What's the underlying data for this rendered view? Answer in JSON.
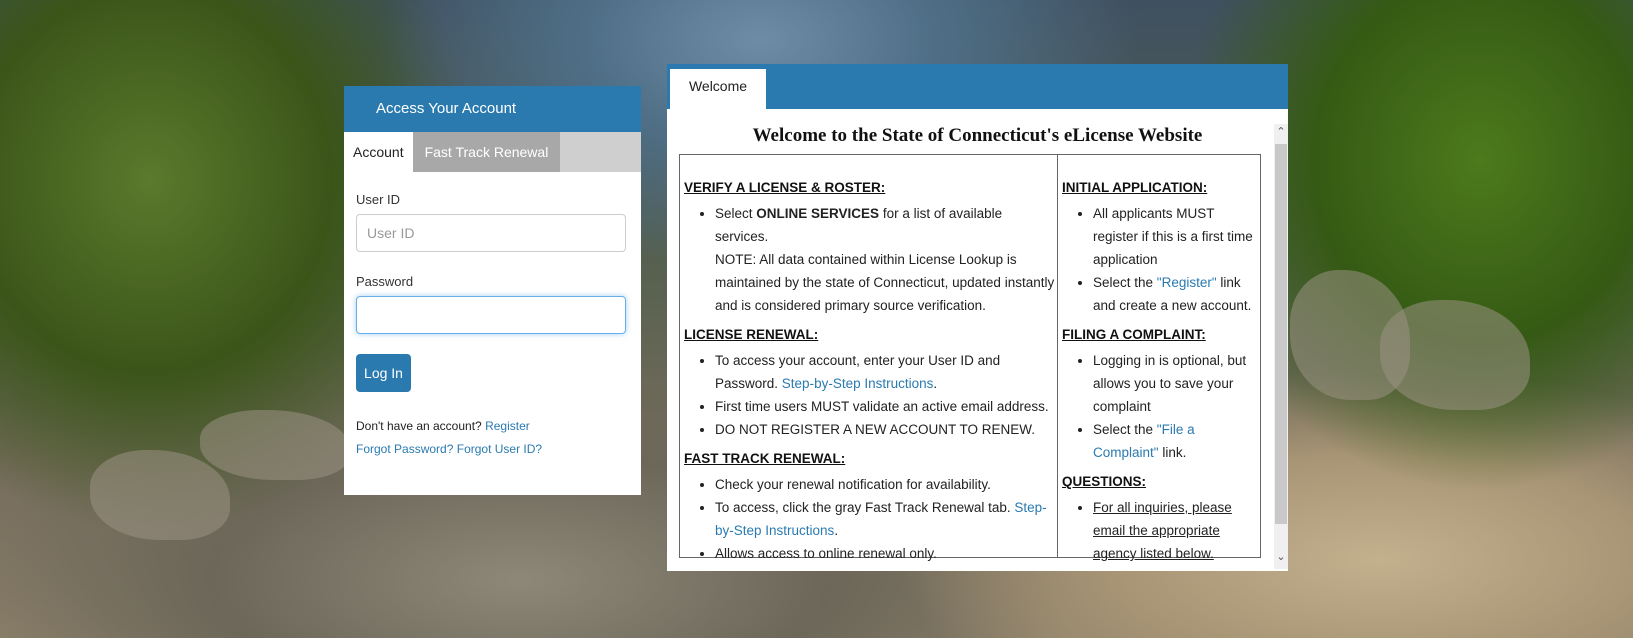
{
  "login": {
    "header": "Access Your Account",
    "tabs": {
      "account": "Account",
      "fast_track": "Fast Track Renewal"
    },
    "user_id_label": "User ID",
    "user_id_placeholder": "User ID",
    "password_label": "Password",
    "login_button": "Log In",
    "no_account_text": "Don't have an account?",
    "register_link": "Register",
    "forgot_password_link": "Forgot Password?",
    "forgot_userid_link": "Forgot User ID?"
  },
  "welcome": {
    "tab": "Welcome",
    "title": "Welcome to the State of Connecticut's eLicense Website",
    "scroll_up_icon": "chevron-up-icon",
    "scroll_down_icon": "chevron-down-icon",
    "left": {
      "verify_head": "VERIFY A LICENSE & ROSTER:",
      "verify_select_pre": "Select ",
      "verify_select_bold": "ONLINE SERVICES",
      "verify_select_post": " for a list of available services.",
      "verify_note": "NOTE: All data contained within License Lookup is maintained by the state of Connecticut, updated instantly and is considered primary source verification.",
      "renewal_head": "LICENSE RENEWAL:",
      "renewal_item1_text": "To access your account, enter your User ID and Password.",
      "renewal_item1_link": "Step-by-Step Instructions",
      "renewal_item2": "First time users MUST validate an active email address.",
      "renewal_item3": "DO NOT REGISTER A NEW ACCOUNT TO RENEW.",
      "fast_head": "FAST TRACK RENEWAL:",
      "fast_item1": "Check your renewal notification for availability.",
      "fast_item2_text": "To access, click the gray Fast Track Renewal tab.",
      "fast_item2_link": "Step-by-Step Instructions",
      "fast_item3": "Allows access to online renewal only."
    },
    "right": {
      "initial_head": "INITIAL APPLICATION:",
      "initial_item1": "All applicants MUST register if this is a first time application",
      "initial_item2_pre": "Select the ",
      "initial_item2_link": "\"Register\"",
      "initial_item2_post": " link and create a new account.",
      "complaint_head": "FILING A COMPLAINT:",
      "complaint_item1": "Logging in is optional, but allows you to save your complaint",
      "complaint_item2_pre": "Select the ",
      "complaint_item2_link": "\"File a Complaint\"",
      "complaint_item2_post": " link.",
      "questions_head": "QUESTIONS:",
      "questions_item1": "For all inquiries, please email the appropriate agency listed below."
    }
  }
}
